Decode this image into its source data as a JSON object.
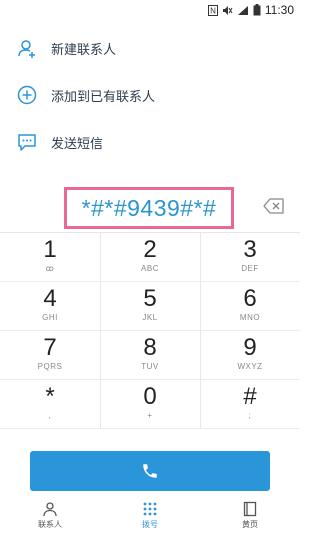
{
  "statusbar": {
    "time": "11:30",
    "icons": [
      "nfc-icon",
      "mute-icon",
      "signal-icon",
      "battery-icon"
    ]
  },
  "actions": [
    {
      "label": "新建联系人",
      "icon": "person-add-icon"
    },
    {
      "label": "添加到已有联系人",
      "icon": "plus-circle-icon"
    },
    {
      "label": "发送短信",
      "icon": "message-icon"
    }
  ],
  "dialer": {
    "number": "*#*#9439#*#",
    "backspace_icon": "backspace-icon"
  },
  "keypad": [
    {
      "digit": "1",
      "letters": "ꝏ"
    },
    {
      "digit": "2",
      "letters": "ABC"
    },
    {
      "digit": "3",
      "letters": "DEF"
    },
    {
      "digit": "4",
      "letters": "GHI"
    },
    {
      "digit": "5",
      "letters": "JKL"
    },
    {
      "digit": "6",
      "letters": "MNO"
    },
    {
      "digit": "7",
      "letters": "PQRS"
    },
    {
      "digit": "8",
      "letters": "TUV"
    },
    {
      "digit": "9",
      "letters": "WXYZ"
    },
    {
      "digit": "*",
      "letters": ","
    },
    {
      "digit": "0",
      "letters": "+"
    },
    {
      "digit": "#",
      "letters": ";"
    }
  ],
  "call_button": {
    "icon": "phone-icon"
  },
  "bottomnav": [
    {
      "label": "联系人",
      "icon": "contacts-icon",
      "active": false
    },
    {
      "label": "拨号",
      "icon": "dialpad-icon",
      "active": true
    },
    {
      "label": "黄页",
      "icon": "yellow-pages-icon",
      "active": false
    }
  ],
  "colors": {
    "accent": "#2a95d8",
    "highlight_border": "#e86a92",
    "number_text": "#2a95d0"
  }
}
